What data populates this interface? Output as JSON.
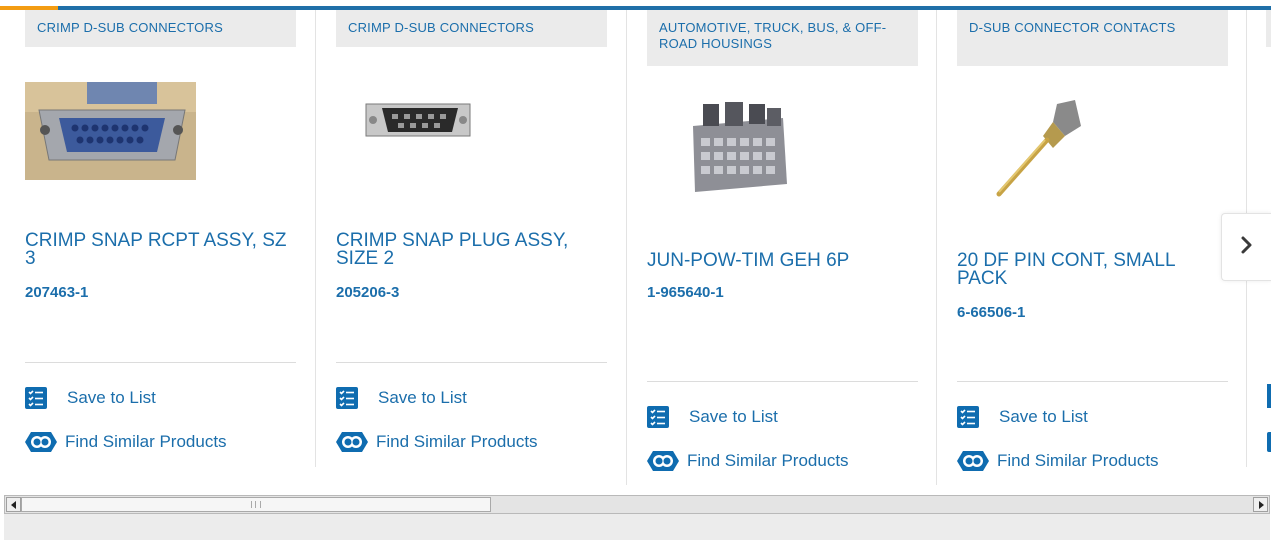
{
  "products": [
    {
      "category": "CRIMP D-SUB CONNECTORS",
      "title": "CRIMP SNAP RCPT ASSY, SZ 3",
      "part_number": "207463-1",
      "save_label": "Save to List",
      "similar_label": "Find Similar Products",
      "image_icon": "dsub-receptacle-image"
    },
    {
      "category": "CRIMP D-SUB CONNECTORS",
      "title": "CRIMP SNAP PLUG ASSY, SIZE 2",
      "part_number": "205206-3",
      "save_label": "Save to List",
      "similar_label": "Find Similar Products",
      "image_icon": "dsub-plug-image"
    },
    {
      "category": "AUTOMOTIVE, TRUCK, BUS, & OFF-ROAD HOUSINGS",
      "title": "JUN-POW-TIM GEH 6P",
      "part_number": "1-965640-1",
      "save_label": "Save to List",
      "similar_label": "Find Similar Products",
      "image_icon": "automotive-housing-image"
    },
    {
      "category": "D-SUB CONNECTOR CONTACTS",
      "title": "20 DF PIN CONT, SMALL PACK",
      "part_number": "6-66506-1",
      "save_label": "Save to List",
      "similar_label": "Find Similar Products",
      "image_icon": "pin-contact-image"
    }
  ],
  "carousel": {
    "next_icon": "chevron-right-icon"
  },
  "colors": {
    "accent": "#1b6eab",
    "icon_blue": "#0f6cb0",
    "top_orange": "#f39c12"
  }
}
